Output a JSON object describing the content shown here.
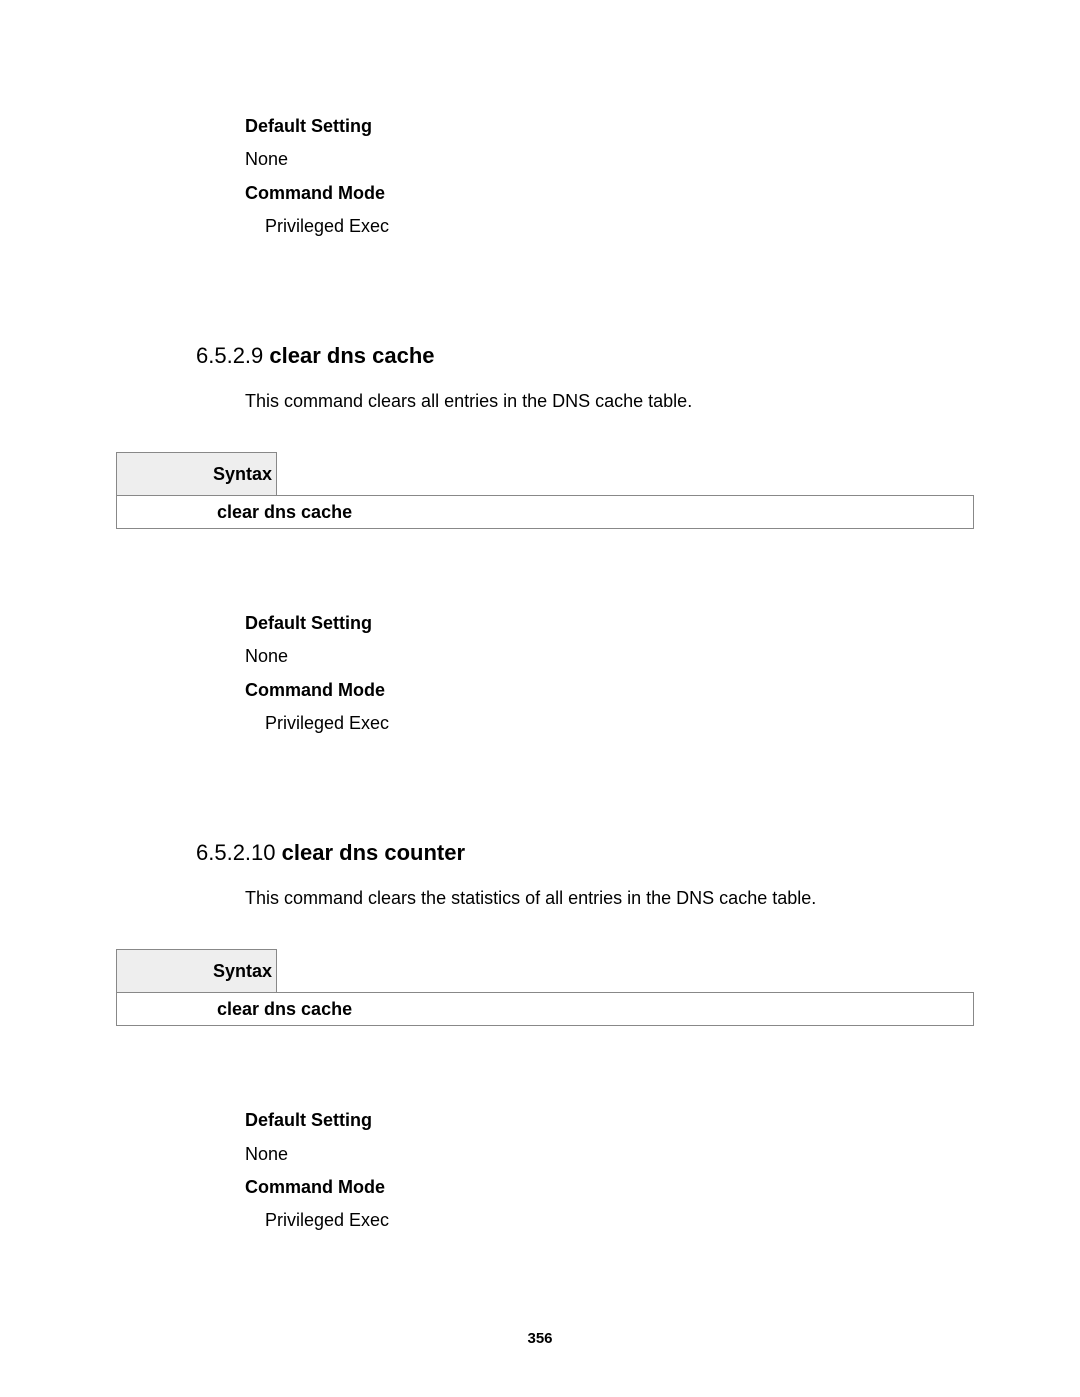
{
  "topBlock": {
    "defaultSettingLabel": "Default Setting",
    "defaultSettingValue": "None",
    "commandModeLabel": "Command Mode",
    "commandModeValue": "Privileged Exec"
  },
  "section1": {
    "number": "6.5.2.9",
    "title": "clear dns cache",
    "description": "This command clears all entries in the DNS cache table.",
    "syntaxLabel": "Syntax",
    "syntaxBody": "clear dns cache",
    "details": {
      "defaultSettingLabel": "Default Setting",
      "defaultSettingValue": "None",
      "commandModeLabel": "Command Mode",
      "commandModeValue": "Privileged Exec"
    }
  },
  "section2": {
    "number": "6.5.2.10",
    "title": "clear dns counter",
    "description": "This command clears the statistics of all entries in the DNS cache table.",
    "syntaxLabel": "Syntax",
    "syntaxBody": "clear dns cache",
    "details": {
      "defaultSettingLabel": "Default Setting",
      "defaultSettingValue": "None",
      "commandModeLabel": "Command Mode",
      "commandModeValue": "Privileged Exec"
    }
  },
  "pageNumber": "356"
}
